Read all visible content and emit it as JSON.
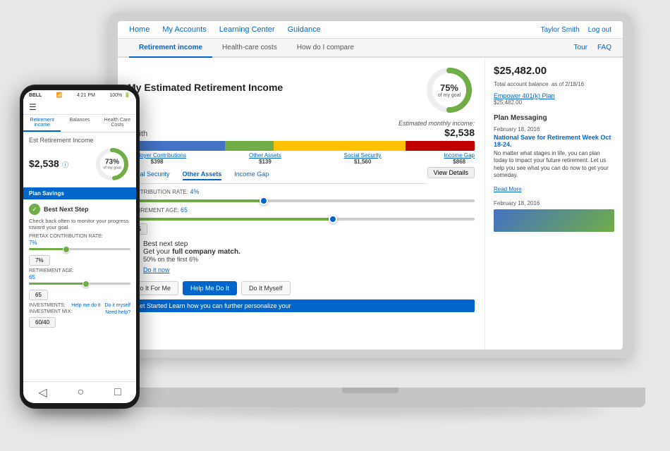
{
  "laptop": {
    "nav": {
      "links": [
        "Home",
        "My Accounts",
        "Learning Center",
        "Guidance"
      ],
      "user": "Taylor Smith",
      "logout": "Log out"
    },
    "tabs": {
      "items": [
        "Retirement income",
        "Health-care costs",
        "How do I compare"
      ],
      "active": 0,
      "right": [
        "Tour",
        "FAQ"
      ]
    },
    "main": {
      "title": "My Estimated Retirement Income",
      "name": "Smith",
      "estimated_label": "Estimated monthly income:",
      "estimated_amount": "$2,538",
      "donut_pct": "75%",
      "donut_sub": "of my goal",
      "bar_labels": [
        {
          "name": "Employer Contributions",
          "value": "$398"
        },
        {
          "name": "Other Assets",
          "value": "$139"
        },
        {
          "name": "Social Security",
          "value": "$1,560"
        },
        {
          "name": "Income Gap",
          "value": "$868"
        }
      ],
      "view_details": "View Details",
      "sub_tabs": [
        "Social Security",
        "Other Assets",
        "Income Gap"
      ],
      "contribution_rate_label": "CONTRIBUTION RATE:",
      "contribution_rate_value": "4%",
      "retirement_age_label": "RETIREMENT AGE:",
      "retirement_age_value": "65",
      "slider_value": "65",
      "best_next_step": "Best next step",
      "bns_text": "Get your",
      "bns_bold": "full company match.",
      "bns_detail": "50% on the first 6%",
      "bns_link": "Do it now",
      "action_buttons": [
        "Do It For Me",
        "Help Me Do It",
        "Do It Myself"
      ],
      "started_bar": "Get Started",
      "started_detail": "Learn how you can further personalize your"
    },
    "right": {
      "balance": "$25,482.00",
      "balance_label": "Total account balance",
      "balance_date": "as of 2/18/16",
      "plan_name": "Empower 401(k) Plan",
      "plan_amount": "$25,482.00",
      "messaging_title": "Plan Messaging",
      "messages": [
        {
          "date": "February 18, 2016",
          "headline": "National Save for Retirement Week Oct 18-24.",
          "body": "No matter what stages in life, you can plan today to impact your future retirement. Let us help you see what you can do now to get your someday.",
          "link": "Read More"
        },
        {
          "date": "February 18, 2016",
          "headline": "",
          "body": "",
          "link": ""
        }
      ]
    }
  },
  "phone": {
    "status": {
      "carrier": "BELL",
      "time": "4:21 PM",
      "battery": "100%"
    },
    "tabs": [
      "Retirement income",
      "Balances",
      "Health Care Costs"
    ],
    "ret_title": "Est Retirement Income",
    "ret_amount": "$2,538",
    "donut_pct": "73%",
    "donut_sub": "of my goal",
    "blue_bar": "Plan Savings",
    "bns_title": "Best Next Step",
    "bns_body": "Check back often to monitor your progress toward your goal.",
    "pretax_label": "PRETAX CONTRIBUTION RATE:",
    "pretax_value": "7%",
    "pretax_slider": "7%",
    "retirement_age_label": "RETIREMENT AGE:",
    "retirement_age_value": "65",
    "slider_val": "65",
    "investments_label": "INVESTMENTS:",
    "investments_opt1": "Help me do it",
    "investments_opt2": "Do it myself",
    "investment_mix_label": "INVESTMENT MIX:",
    "investment_mix_value": "60/40",
    "need_help": "Need help?",
    "mix_val": "60/40"
  }
}
